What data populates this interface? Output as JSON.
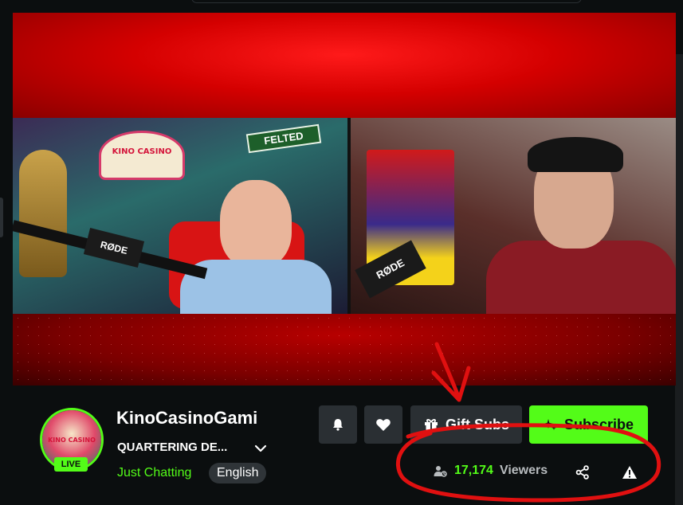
{
  "video": {
    "left_cam_sign": "KINO CASINO",
    "left_cam_street_sign": "FELTED",
    "left_cam_mic_brand": "RØDE",
    "right_cam_mic_brand": "RØDE"
  },
  "channel": {
    "name": "KinoCasinoGami",
    "stream_title": "QUARTERING DE...",
    "category": "Just Chatting",
    "language": "English",
    "live_label": "LIVE",
    "avatar_text": "KINO CASINO"
  },
  "actions": {
    "gift_subs_label": "Gift Subs",
    "subscribe_label": "Subscribe"
  },
  "stats": {
    "viewer_count": "17,174",
    "viewers_label": "Viewers"
  },
  "colors": {
    "accent": "#53fc18",
    "background": "#0b0e0f",
    "button_bg": "#2a2f33",
    "annotation": "#e01010"
  },
  "icons": [
    "bell-icon",
    "heart-icon",
    "gift-icon",
    "subscribe-star-icon",
    "viewers-icon",
    "share-icon",
    "report-icon",
    "chevron-down-icon"
  ]
}
